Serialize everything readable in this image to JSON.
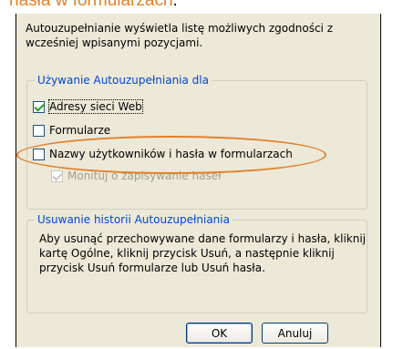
{
  "caption": {
    "text": "hasła w formularzach",
    "tail": "."
  },
  "dialog": {
    "intro": "Autouzupełnianie wyświetla listę możliwych zgodności z wcześniej wpisanymi pozycjami.",
    "use_group": {
      "title": "Używanie Autouzupełniania dla",
      "options": [
        {
          "label": "Adresy sieci Web",
          "checked": true
        },
        {
          "label": "Formularze",
          "checked": false
        },
        {
          "label": "Nazwy użytkowników i hasła w formularzach",
          "checked": false
        },
        {
          "label": "Monituj o zapisywanie haseł",
          "checked": true,
          "disabled": true
        }
      ]
    },
    "history_group": {
      "title": "Usuwanie historii Autouzupełniania",
      "text": "Aby usunąć przechowywane dane formularzy i hasła, kliknij kartę Ogólne, kliknij przycisk Usuń, a następnie kliknij przycisk Usuń formularze lub Usuń hasła."
    },
    "ok_label": "OK",
    "cancel_label": "Anuluj"
  },
  "colors": {
    "accent": "#e3812a",
    "dialog_bg": "#ece9d8",
    "group_title": "#0046d5"
  }
}
